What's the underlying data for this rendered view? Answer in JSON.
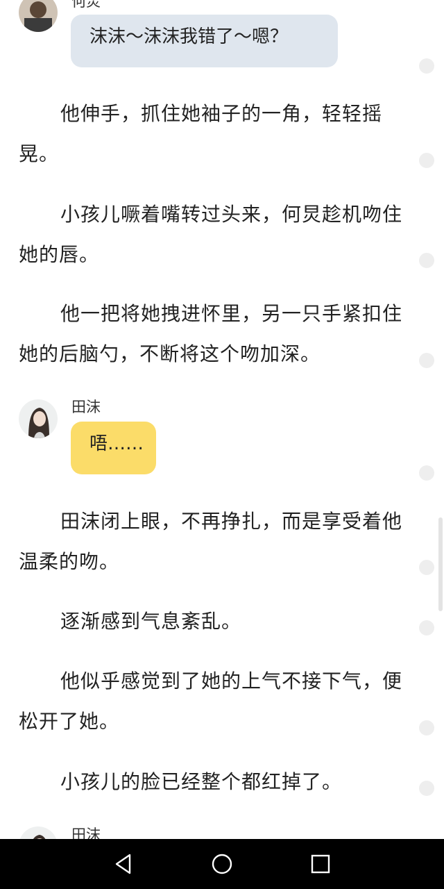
{
  "messages": [
    {
      "speaker": "何炅",
      "text": "沫沫～沫沫我错了～嗯？"
    },
    {
      "speaker": "田沫",
      "text": "唔……"
    },
    {
      "speaker": "田沫"
    }
  ],
  "paragraphs": [
    "他伸手，抓住她袖子的一角，轻轻摇晃。",
    "小孩儿噘着嘴转过头来，何炅趁机吻住她的唇。",
    "他一把将她拽进怀里，另一只手紧扣住她的后脑勺，不断将这个吻加深。",
    "田沫闭上眼，不再挣扎，而是享受着他温柔的吻。",
    "逐渐感到气息紊乱。",
    "他似乎感觉到了她的上气不接下气，便松开了她。",
    "小孩儿的脸已经整个都红掉了。"
  ],
  "colors": {
    "bubble_blue": "#dfe6ee",
    "bubble_yellow": "#fbdc69",
    "navbar": "#000000"
  },
  "navbar": {
    "icons": [
      "back-triangle-icon",
      "home-circle-icon",
      "recents-square-icon"
    ]
  }
}
